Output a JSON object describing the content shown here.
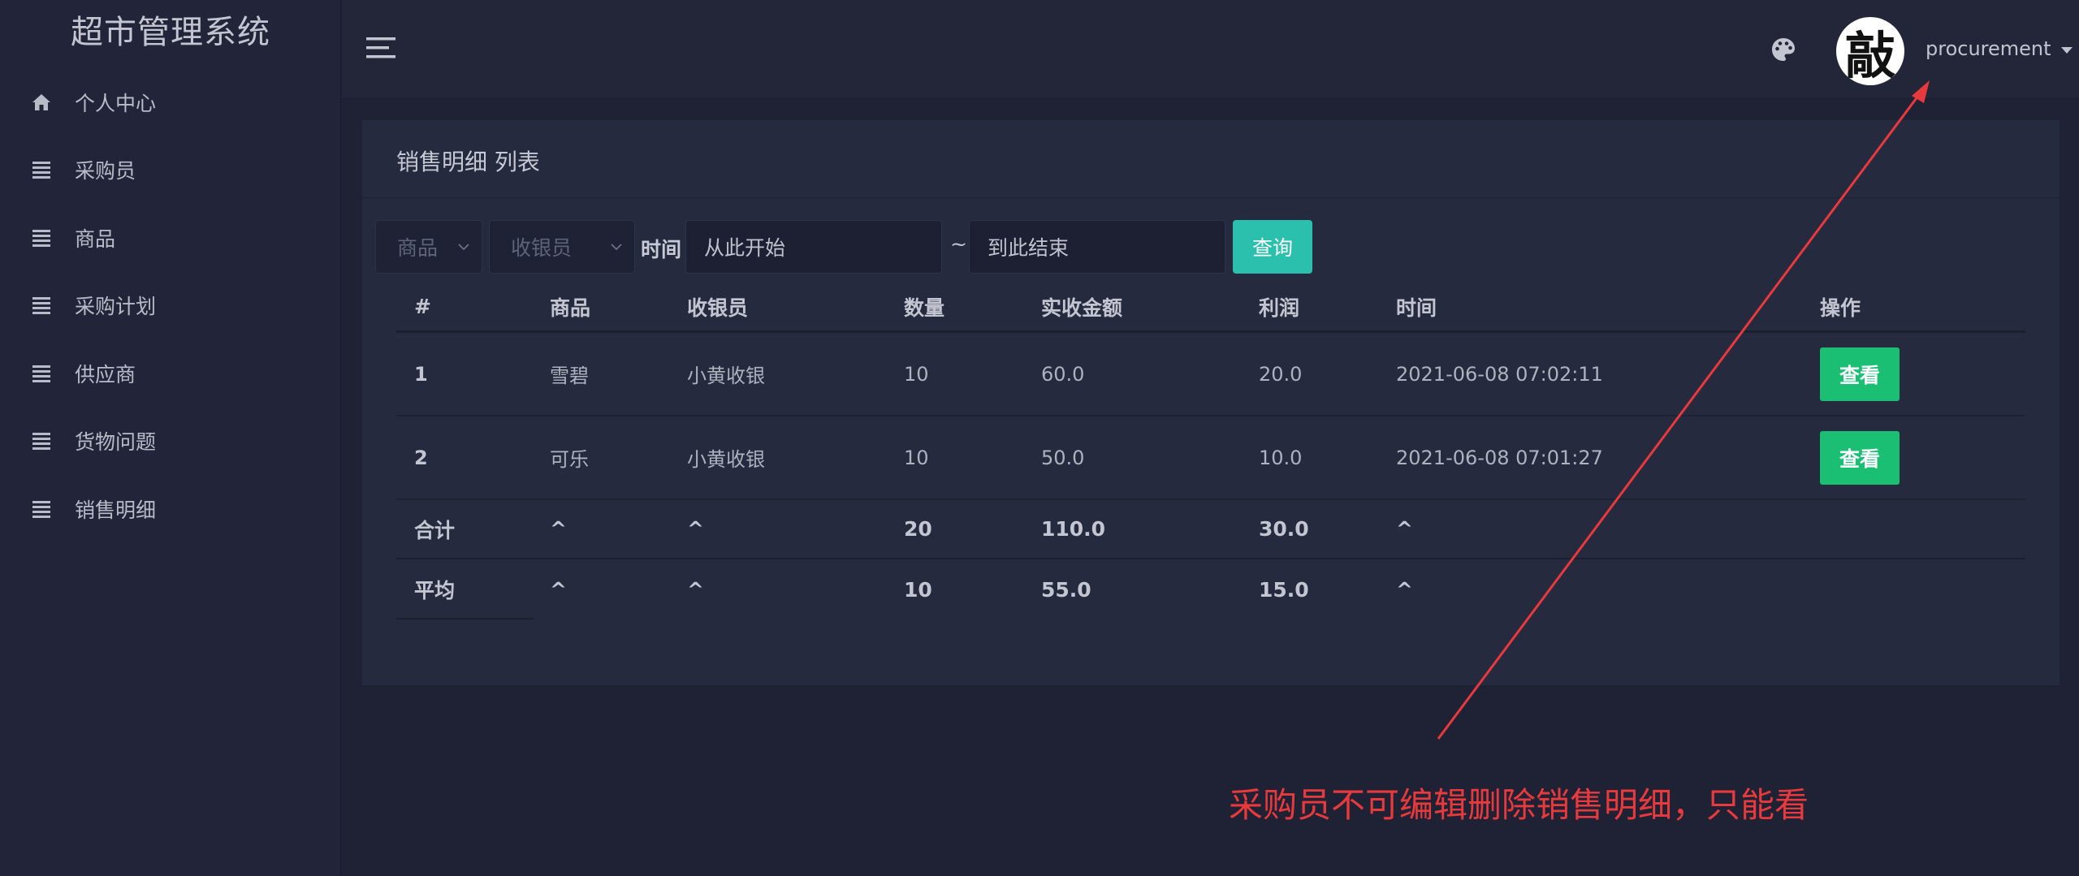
{
  "app": {
    "title": "超市管理系统"
  },
  "sidebar": {
    "items": [
      {
        "label": "个人中心",
        "icon": "home-icon"
      },
      {
        "label": "采购员",
        "icon": "list-icon"
      },
      {
        "label": "商品",
        "icon": "list-icon"
      },
      {
        "label": "采购计划",
        "icon": "list-icon"
      },
      {
        "label": "供应商",
        "icon": "list-icon"
      },
      {
        "label": "货物问题",
        "icon": "list-icon"
      },
      {
        "label": "销售明细",
        "icon": "list-icon"
      }
    ]
  },
  "header": {
    "menu_icon": "hamburger-icon",
    "theme_icon": "palette-icon",
    "avatar_char": "敲",
    "username": "procurement"
  },
  "card": {
    "title": "销售明细 列表"
  },
  "filters": {
    "product_placeholder": "商品",
    "cashier_placeholder": "收银员",
    "time_label": "时间",
    "start_placeholder": "从此开始",
    "separator": "~",
    "end_placeholder": "到此结束",
    "query_label": "查询"
  },
  "table": {
    "headers": [
      "#",
      "商品",
      "收银员",
      "数量",
      "实收金额",
      "利润",
      "时间",
      "操作"
    ],
    "rows": [
      {
        "index": "1",
        "product": "雪碧",
        "cashier": "小黄收银",
        "qty": "10",
        "amount": "60.0",
        "profit": "20.0",
        "time": "2021-06-08 07:02:11",
        "action": "查看"
      },
      {
        "index": "2",
        "product": "可乐",
        "cashier": "小黄收银",
        "qty": "10",
        "amount": "50.0",
        "profit": "10.0",
        "time": "2021-06-08 07:01:27",
        "action": "查看"
      }
    ],
    "summary": {
      "label": "合计",
      "product": "^",
      "cashier": "^",
      "qty": "20",
      "amount": "110.0",
      "profit": "30.0",
      "time": "^"
    },
    "average": {
      "label": "平均",
      "product": "^",
      "cashier": "^",
      "qty": "10",
      "amount": "55.0",
      "profit": "15.0",
      "time": "^"
    }
  },
  "annotation": {
    "text": "采购员不可编辑删除销售明细，只能看",
    "color": "#e8393c"
  },
  "colors": {
    "sidebar_bg": "#222539",
    "content_bg": "#1f2235",
    "card_bg": "#262a3e",
    "query_button": "#2bbfae",
    "view_button": "#1bbf73"
  }
}
